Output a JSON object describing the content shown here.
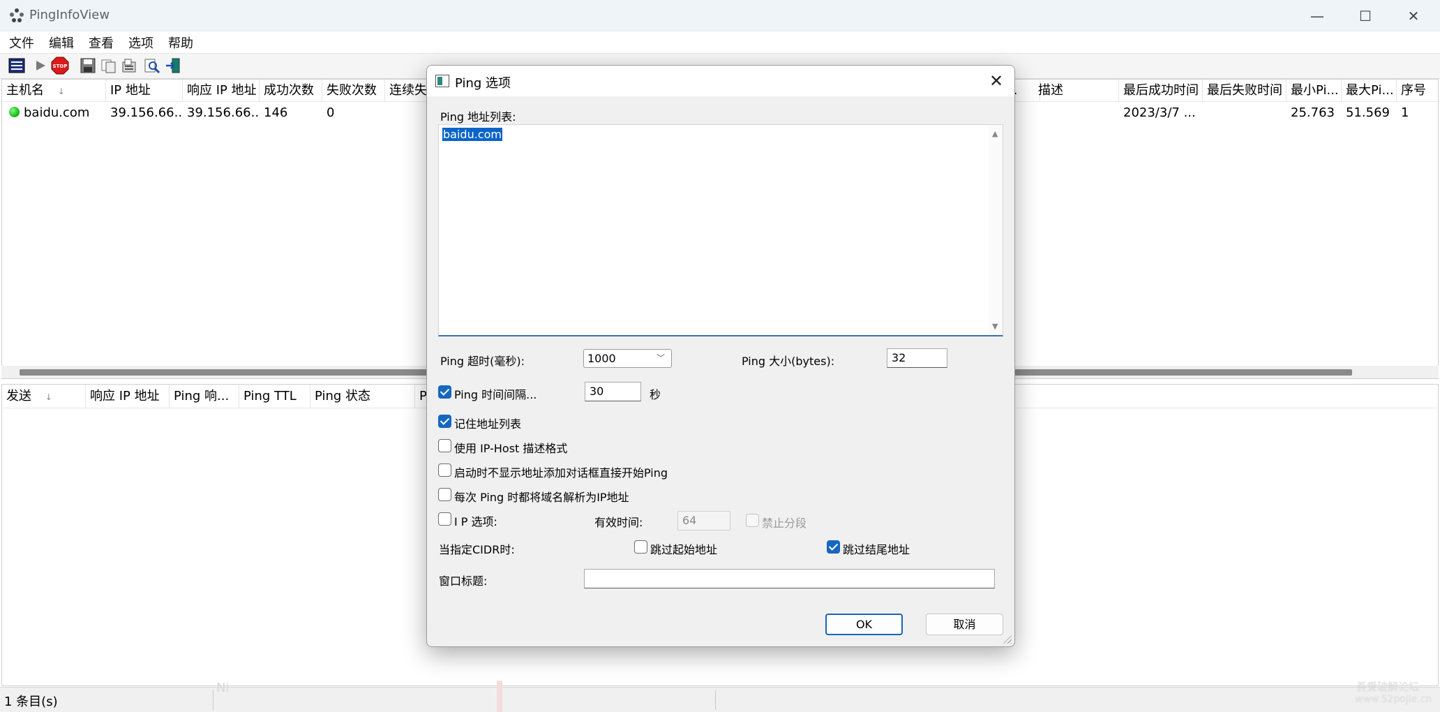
{
  "window": {
    "title": "PingInfoView",
    "min_icon": "—",
    "max_icon": "☐",
    "close_icon": "✕"
  },
  "menu": [
    "文件",
    "编辑",
    "查看",
    "选项",
    "帮助"
  ],
  "upper_table": {
    "columns": [
      "主机名",
      "IP 地址",
      "响应 IP 地址",
      "成功次数",
      "失败次数",
      "连续失",
      "Ping...",
      "描述",
      "最后成功时间",
      "最后失败时间",
      "最小Pi...",
      "最大Pi...",
      "序号"
    ],
    "sort_indicator": "↓",
    "rows": [
      {
        "host": "baidu.com",
        "ip": "39.156.66...",
        "reply_ip": "39.156.66...",
        "success": "146",
        "fail": "0",
        "last_success": "2023/3/7 ...",
        "min_ping": "25.763",
        "max_ping": "51.569",
        "index": "1"
      }
    ]
  },
  "lower_table": {
    "columns": [
      "发送",
      "响应 IP 地址",
      "Ping 响...",
      "Ping TTL",
      "Ping 状态",
      "P"
    ]
  },
  "status": {
    "count": "1 条目(s)",
    "ghost": "Ni"
  },
  "watermark": {
    "line1": "吾爱破解论坛",
    "line2": "www.52pojie.cn"
  },
  "dialog": {
    "title": "Ping 选项",
    "close_icon": "✕",
    "address_list_label": "Ping 地址列表:",
    "address_list_value": "baidu.com",
    "timeout_label": "Ping 超时(毫秒):",
    "timeout_value": "1000",
    "size_label": "Ping 大小(bytes):",
    "size_value": "32",
    "interval_label": "Ping 时间间隔...",
    "interval_value": "30",
    "interval_unit": "秒",
    "remember_label": "记住地址列表",
    "iphost_label": "使用 IP-Host 描述格式",
    "no_dialog_label": "启动时不显示地址添加对话框直接开始Ping",
    "resolve_label": "每次 Ping 时都将域名解析为IP地址",
    "ip_options_label": "I P 选项:",
    "ttl_label": "有效时间:",
    "ttl_value": "64",
    "no_fragment_label": "禁止分段",
    "cidr_label": "当指定CIDR时:",
    "skip_first_label": "跳过起始地址",
    "skip_last_label": "跳过结尾地址",
    "window_title_label": "窗口标题:",
    "window_title_value": "",
    "ok_label": "OK",
    "cancel_label": "取消"
  }
}
